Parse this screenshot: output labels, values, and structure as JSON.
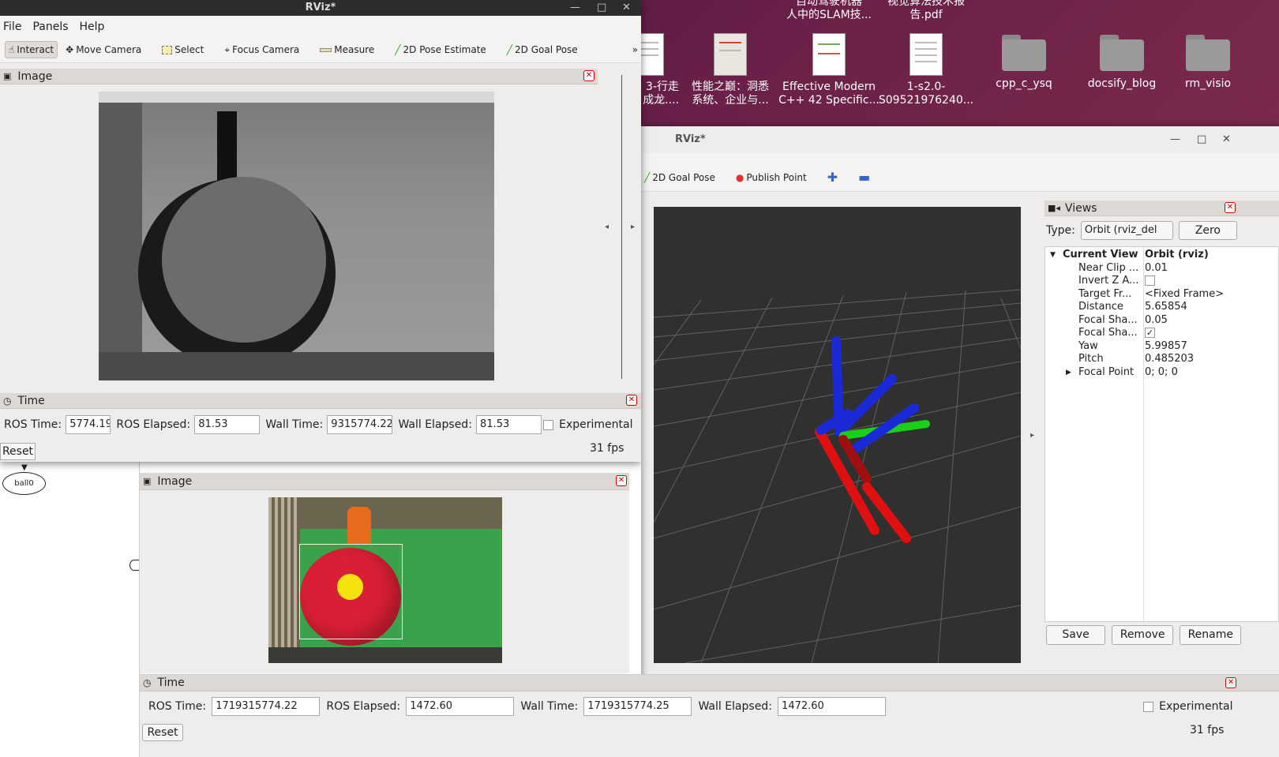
{
  "desktop": {
    "icons": [
      {
        "label": "3-行走\n成龙....",
        "kind": "doc"
      },
      {
        "label": "性能之巅：洞悉\n系统、企业与...",
        "kind": "doc"
      },
      {
        "label": "Effective Modern\nC++ 42 Specific...",
        "kind": "doc"
      },
      {
        "label": "1-s2.0-\nS09521976240...",
        "kind": "doc"
      },
      {
        "label": "cpp_c_ysq",
        "kind": "folder"
      },
      {
        "label": "docsify_blog",
        "kind": "folder"
      },
      {
        "label": "rm_visio",
        "kind": "folder"
      }
    ],
    "top_labels": [
      "自动驾驶机器\n人中的SLAM技...",
      "视觉算法技术报\n告.pdf"
    ]
  },
  "left_window": {
    "title": "RViz*",
    "menu": [
      "File",
      "Panels",
      "Help"
    ],
    "tools": [
      {
        "label": "Interact",
        "icon": "hand-icon"
      },
      {
        "label": "Move Camera",
        "icon": "move-icon"
      },
      {
        "label": "Select",
        "icon": "select-icon"
      },
      {
        "label": "Focus Camera",
        "icon": "focus-icon"
      },
      {
        "label": "Measure",
        "icon": "ruler-icon"
      },
      {
        "label": "2D Pose Estimate",
        "icon": "arrow-green-icon"
      },
      {
        "label": "2D Goal Pose",
        "icon": "arrow-green-icon"
      }
    ],
    "image_panel_title": "Image",
    "time_panel": {
      "title": "Time",
      "ros_time_label": "ROS Time:",
      "ros_time": "5774.19",
      "ros_elapsed_label": "ROS Elapsed:",
      "ros_elapsed": "81.53",
      "wall_time_label": "Wall Time:",
      "wall_time": "9315774.22",
      "wall_elapsed_label": "Wall Elapsed:",
      "wall_elapsed": "81.53",
      "experimental": "Experimental",
      "reset": "Reset",
      "fps": "31 fps"
    }
  },
  "graph": {
    "node": "ball0"
  },
  "lower_left": {
    "image_panel_title": "Image",
    "time_panel": {
      "title": "Time",
      "ros_time_label": "ROS Time:",
      "ros_time": "1719315774.22",
      "ros_elapsed_label": "ROS Elapsed:",
      "ros_elapsed": "1472.60",
      "wall_time_label": "Wall Time:",
      "wall_time": "1719315774.25",
      "wall_elapsed_label": "Wall Elapsed:",
      "wall_elapsed": "1472.60",
      "experimental": "Experimental",
      "reset": "Reset",
      "fps": "31 fps"
    }
  },
  "right_window": {
    "title": "RViz*",
    "tools": [
      {
        "label": "2D Goal Pose",
        "icon": "arrow-green-icon"
      },
      {
        "label": "Publish Point",
        "icon": "pin-icon"
      }
    ],
    "views": {
      "title": "Views",
      "type_label": "Type:",
      "type_value": "Orbit (rviz_del",
      "zero": "Zero",
      "header_key": "Current View",
      "header_value": "Orbit (rviz)",
      "rows": [
        {
          "k": "Near Clip ...",
          "v": "0.01"
        },
        {
          "k": "Invert Z A...",
          "v": "",
          "check": false
        },
        {
          "k": "Target Fr...",
          "v": "<Fixed Frame>"
        },
        {
          "k": "Distance",
          "v": "5.65854"
        },
        {
          "k": "Focal Sha...",
          "v": "0.05"
        },
        {
          "k": "Focal Sha...",
          "v": "",
          "check": true
        },
        {
          "k": "Yaw",
          "v": "5.99857"
        },
        {
          "k": "Pitch",
          "v": "0.485203"
        },
        {
          "k": "Focal Point",
          "v": "0; 0; 0"
        }
      ],
      "save": "Save",
      "remove": "Remove",
      "rename": "Rename"
    }
  }
}
